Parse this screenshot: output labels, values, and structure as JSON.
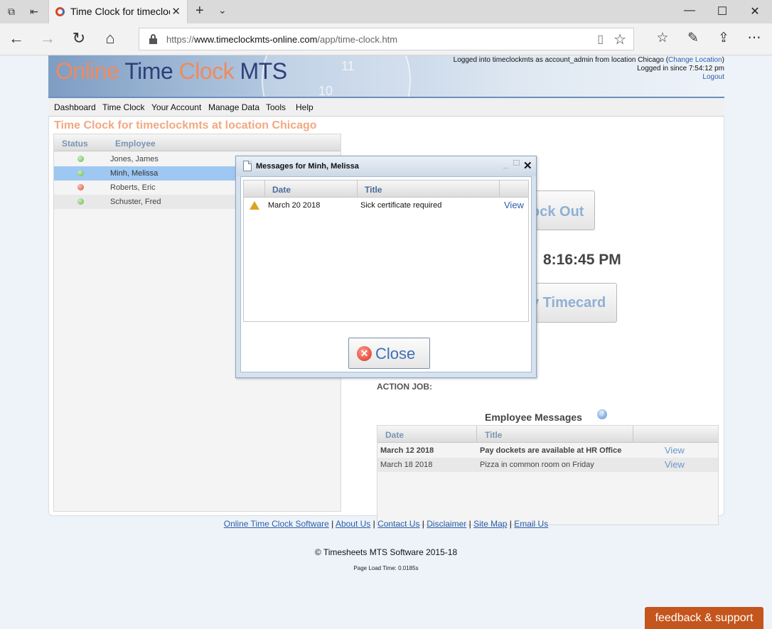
{
  "browser": {
    "tab_title": "Time Clock for timecloc",
    "url_prefix": "https://",
    "url_domain": "www.timeclockmts-online.com",
    "url_path": "/app/time-clock.htm"
  },
  "banner": {
    "logo_online": "Online",
    "logo_time": " Time",
    "logo_clock": " Clock",
    "logo_mts": " MTS",
    "clock_num_11": "11",
    "clock_num_10": "10",
    "login_line1_prefix": "Logged into timeclockmts as account_admin from location Chicago (",
    "change_location": "Change Location",
    "login_line1_suffix": ")",
    "login_line2": "Logged in since 7:54:12 pm",
    "logout": "Logout"
  },
  "menu": [
    "Dashboard",
    "Time Clock",
    "Your Account",
    "Manage Data",
    "Tools",
    "Help"
  ],
  "page_heading": "Time Clock for timeclockmts at location Chicago",
  "employees": {
    "headers": {
      "status": "Status",
      "employee": "Employee"
    },
    "rows": [
      {
        "name": "Jones, James",
        "status": "green"
      },
      {
        "name": "Minh, Melissa",
        "status": "green"
      },
      {
        "name": "Roberts, Eric",
        "status": "red"
      },
      {
        "name": "Schuster, Fred",
        "status": "green"
      }
    ]
  },
  "right": {
    "clock_out_label": "ock Out",
    "time": "8:16:45 PM",
    "timecard_label": "y Timecard",
    "action_job": "ACTION JOB:",
    "employee_messages_title": "Employee Messages",
    "help_glyph": "?"
  },
  "employee_messages": {
    "headers": {
      "date": "Date",
      "title": "Title"
    },
    "rows": [
      {
        "date": "March 12 2018",
        "title": "Pay dockets are available at HR Office",
        "action": "View"
      },
      {
        "date": "March 18 2018",
        "title": "Pizza in common room on Friday",
        "action": "View"
      }
    ]
  },
  "modal": {
    "title": "Messages for Minh, Melissa",
    "headers": {
      "date": "Date",
      "title": "Title"
    },
    "row": {
      "date": "March 20 2018",
      "title": "Sick certificate required",
      "action": "View"
    },
    "close_label": "Close"
  },
  "footer": {
    "links": [
      "Online Time Clock Software",
      "About Us",
      "Contact Us",
      "Disclaimer",
      "Site Map",
      "Email Us"
    ],
    "separator": " | ",
    "copyright": "© Timesheets MTS Software 2015-18",
    "load_time": "Page Load Time: 0.0185s",
    "feedback": "feedback & support"
  }
}
